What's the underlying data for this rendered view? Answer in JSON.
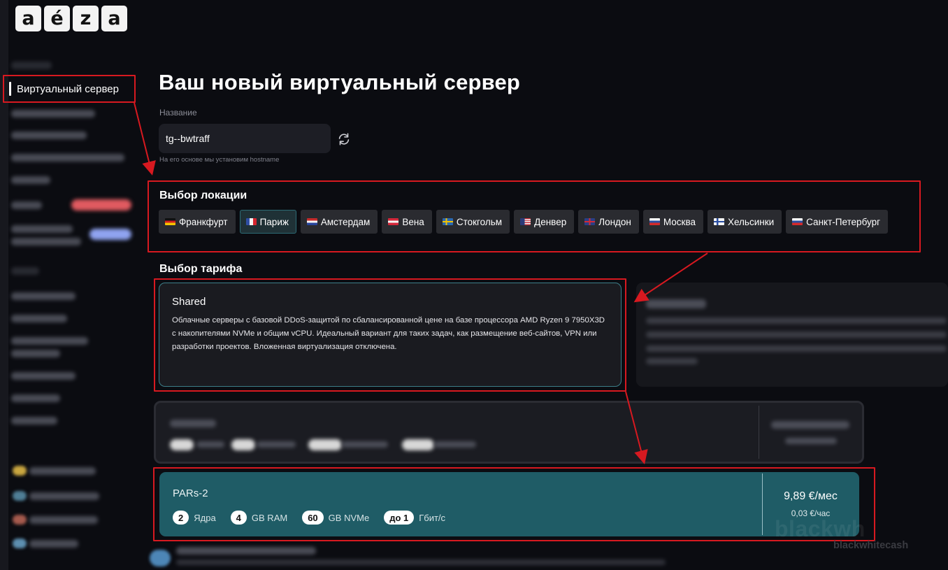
{
  "logo": {
    "letters": [
      "a",
      "é",
      "z",
      "a"
    ]
  },
  "sidebar": {
    "active_item": "Виртуальный сервер"
  },
  "page": {
    "title": "Ваш новый виртуальный сервер",
    "name_label": "Название",
    "name_value": "tg--bwtraff",
    "name_hint": "На его основе мы установим hostname"
  },
  "locations": {
    "title": "Выбор локации",
    "selected": "Париж",
    "items": [
      {
        "label": "Франкфурт",
        "flag": "de"
      },
      {
        "label": "Париж",
        "flag": "fr"
      },
      {
        "label": "Амстердам",
        "flag": "nl"
      },
      {
        "label": "Вена",
        "flag": "at"
      },
      {
        "label": "Стокгольм",
        "flag": "se"
      },
      {
        "label": "Денвер",
        "flag": "us"
      },
      {
        "label": "Лондон",
        "flag": "gb"
      },
      {
        "label": "Москва",
        "flag": "ru"
      },
      {
        "label": "Хельсинки",
        "flag": "fi"
      },
      {
        "label": "Санкт-Петербург",
        "flag": "ru"
      }
    ]
  },
  "tariff": {
    "title": "Выбор тарифа",
    "card_title": "Shared",
    "card_description": "Облачные серверы с базовой DDoS-защитой по сбалансированной цене на базе процессора AMD Ryzen 9 7950X3D с накопителями NVMe и общим vCPU. Идеальный вариант для таких задач, как размещение веб-сайтов, VPN или разработки проектов. Вложенная виртуализация отключена."
  },
  "plan": {
    "name": "PARs-2",
    "specs": [
      {
        "value": "2",
        "unit": "Ядра"
      },
      {
        "value": "4",
        "unit": "GB RAM"
      },
      {
        "value": "60",
        "unit": "GB NVMe"
      },
      {
        "value": "до 1",
        "unit": "Гбит/с"
      }
    ],
    "price_month": "9,89 €/мес",
    "price_hour": "0,03 €/час"
  },
  "watermark": {
    "big": "blackwh",
    "small": "blackwhitecash"
  },
  "colors": {
    "accent_teal": "#1f5c66",
    "highlight_red": "#d71920",
    "background": "#0b0c11"
  }
}
